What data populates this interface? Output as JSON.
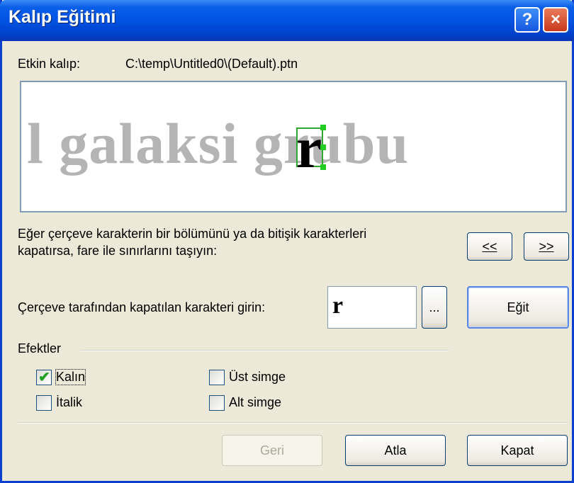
{
  "window": {
    "title": "Kalıp Eğitimi",
    "help_glyph": "?",
    "close_glyph": "×"
  },
  "active_pattern": {
    "label": "Etkin kalıp:",
    "path": "C:\\temp\\Untitled0\\(Default).ptn"
  },
  "preview": {
    "sample_text": "l galaksi grubu",
    "current_char": "r"
  },
  "instruction": {
    "line1": "Eğer çerçeve karakterin bir bölümünü ya da bitişik karakterleri",
    "line2": "kapatırsa, fare ile sınırlarını taşıyın:"
  },
  "nav": {
    "prev_label": "<<",
    "next_label": ">>"
  },
  "char_entry": {
    "label": "Çerçeve tarafından kapatılan karakteri girin:",
    "value": "r",
    "browse_label": "...",
    "train_label": "Eğit"
  },
  "effects": {
    "header": "Efektler",
    "bold": {
      "label": "Kalın",
      "checked": true
    },
    "italic": {
      "label": "İtalik",
      "checked": false
    },
    "superscript": {
      "label": "Üst simge",
      "checked": false
    },
    "subscript": {
      "label": "Alt simge",
      "checked": false
    }
  },
  "footer": {
    "back_label": "Geri",
    "skip_label": "Atla",
    "close_label": "Kapat"
  },
  "colors": {
    "title_bar": "#0153e3",
    "check_green": "#21a121",
    "selection_green": "#22cc22"
  }
}
